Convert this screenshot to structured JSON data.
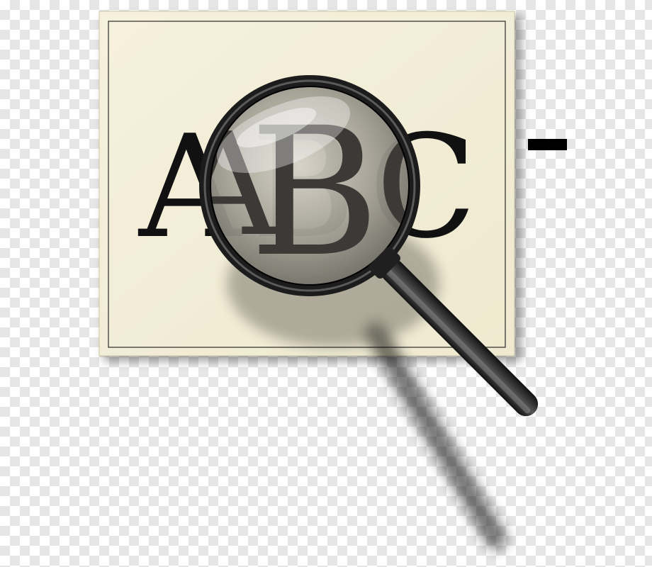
{
  "illustration": {
    "page_letters": [
      "A",
      "B",
      "C"
    ],
    "magnified_letter": "B",
    "icon": "magnifying-glass-icon",
    "colors": {
      "paper": "#f4efd9",
      "ink": "#111111",
      "lens_tint": "#9a9890",
      "handle": "#2a2a2a",
      "rim": "#1c1c1c"
    }
  }
}
